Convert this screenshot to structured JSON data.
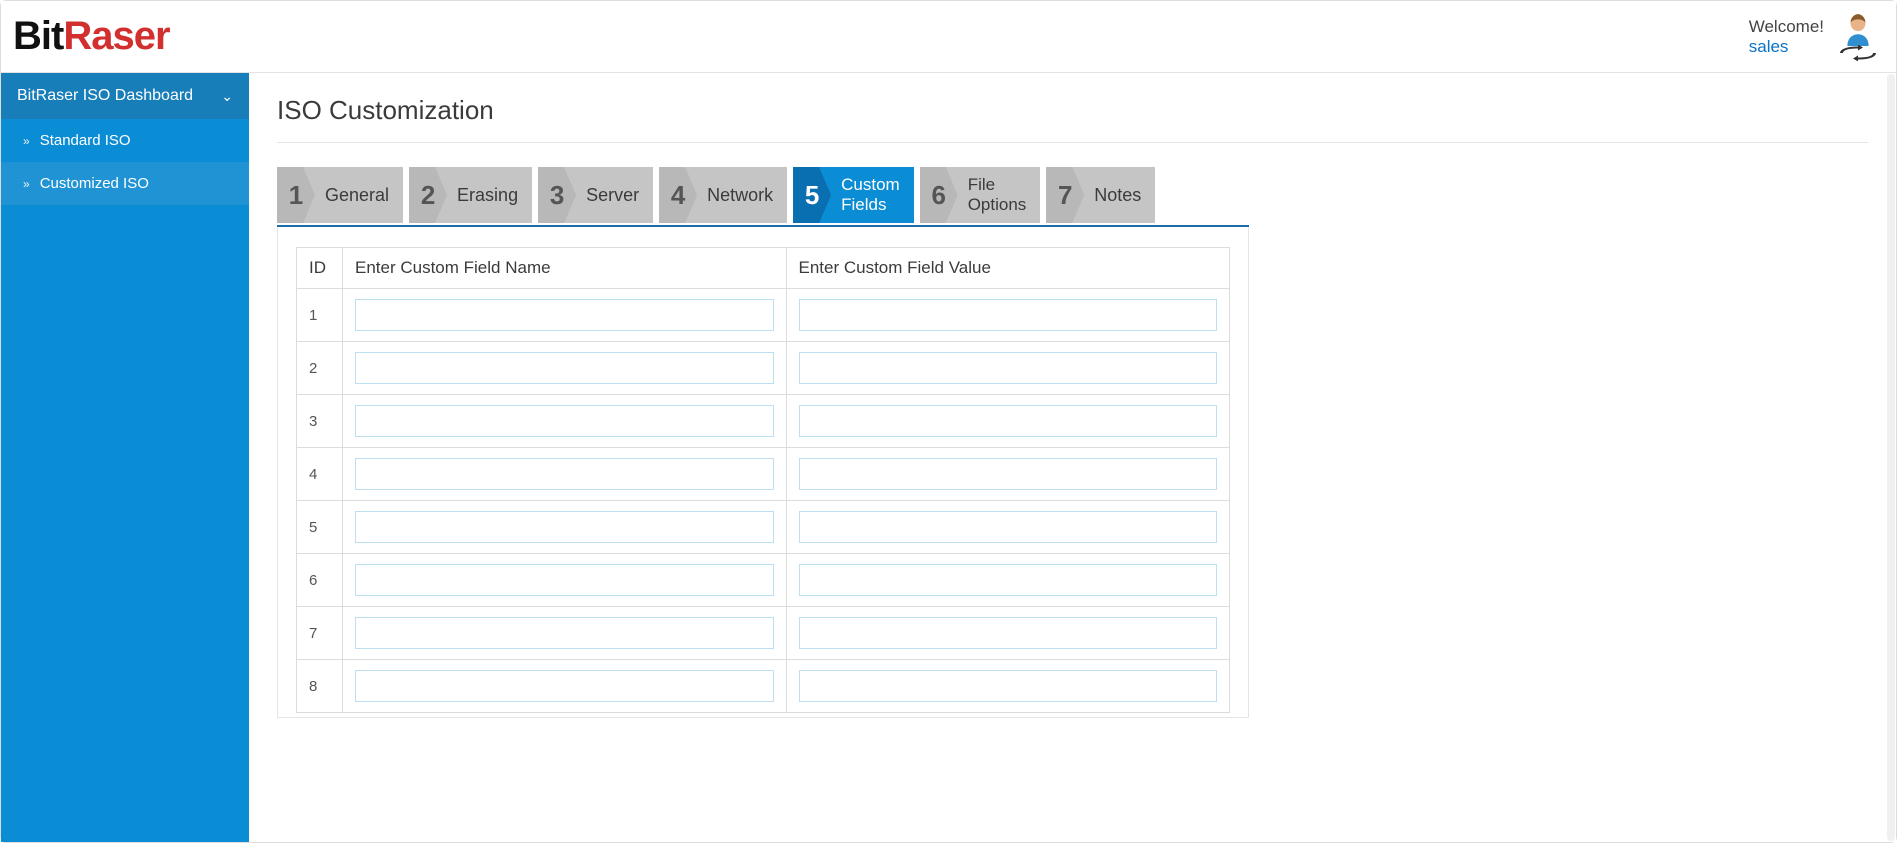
{
  "header": {
    "logo_part1": "Bit",
    "logo_part2": "Raser",
    "welcome_label": "Welcome!",
    "user_name": "sales"
  },
  "sidebar": {
    "section_title": "BitRaser ISO Dashboard",
    "items": [
      {
        "label": "Standard ISO",
        "active": false
      },
      {
        "label": "Customized ISO",
        "active": true
      }
    ]
  },
  "page": {
    "title": "ISO Customization"
  },
  "steps": [
    {
      "num": "1",
      "label": "General",
      "active": false
    },
    {
      "num": "2",
      "label": "Erasing",
      "active": false
    },
    {
      "num": "3",
      "label": "Server",
      "active": false
    },
    {
      "num": "4",
      "label": "Network",
      "active": false
    },
    {
      "num": "5",
      "label": "Custom Fields",
      "active": true
    },
    {
      "num": "6",
      "label": "File Options",
      "active": false
    },
    {
      "num": "7",
      "label": "Notes",
      "active": false
    }
  ],
  "table": {
    "headers": {
      "id": "ID",
      "name": "Enter Custom Field Name",
      "value": "Enter Custom Field Value"
    },
    "rows": [
      {
        "id": "1",
        "name": "",
        "value": ""
      },
      {
        "id": "2",
        "name": "",
        "value": ""
      },
      {
        "id": "3",
        "name": "",
        "value": ""
      },
      {
        "id": "4",
        "name": "",
        "value": ""
      },
      {
        "id": "5",
        "name": "",
        "value": ""
      },
      {
        "id": "6",
        "name": "",
        "value": ""
      },
      {
        "id": "7",
        "name": "",
        "value": ""
      },
      {
        "id": "8",
        "name": "",
        "value": ""
      }
    ]
  }
}
